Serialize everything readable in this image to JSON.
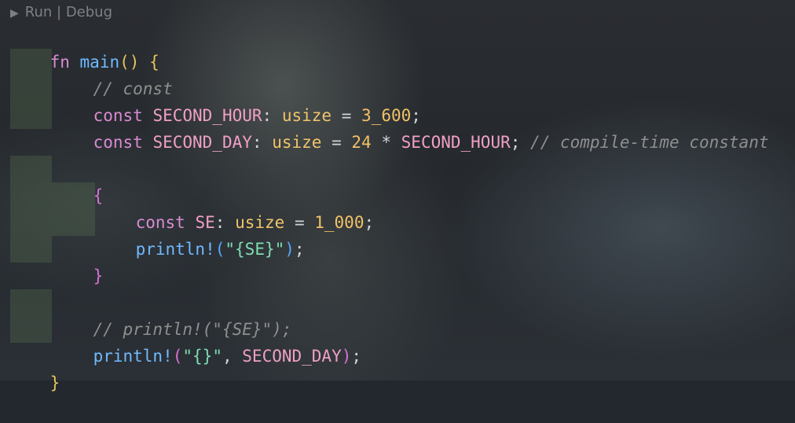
{
  "codelens": {
    "run": "Run",
    "separator": " | ",
    "debug": "Debug"
  },
  "code": {
    "line1": {
      "fn": "fn",
      "name": "main",
      "parens": "()",
      "brace": "{"
    },
    "line2": {
      "comment": "// const"
    },
    "line3": {
      "kw": "const",
      "name": "SECOND_HOUR",
      "colon": ":",
      "type": "usize",
      "eq": "=",
      "value": "3_600",
      "semi": ";"
    },
    "line4": {
      "kw": "const",
      "name": "SECOND_DAY",
      "colon": ":",
      "type": "usize",
      "eq": "=",
      "value": "24",
      "op": "*",
      "ref": "SECOND_HOUR",
      "semi": ";",
      "comment": "// compile-time constant"
    },
    "line6": {
      "brace": "{"
    },
    "line7": {
      "kw": "const",
      "name": "SE",
      "colon": ":",
      "type": "usize",
      "eq": "=",
      "value": "1_000",
      "semi": ";"
    },
    "line8": {
      "macro": "println!",
      "open": "(",
      "str": "\"{SE}\"",
      "close": ")",
      "semi": ";"
    },
    "line9": {
      "brace": "}"
    },
    "line11": {
      "comment": "// println!(\"{SE}\");"
    },
    "line12": {
      "macro": "println!",
      "open": "(",
      "str": "\"{}\"",
      "comma": ",",
      "arg": "SECOND_DAY",
      "close": ")",
      "semi": ";"
    },
    "line13": {
      "brace": "}"
    }
  }
}
